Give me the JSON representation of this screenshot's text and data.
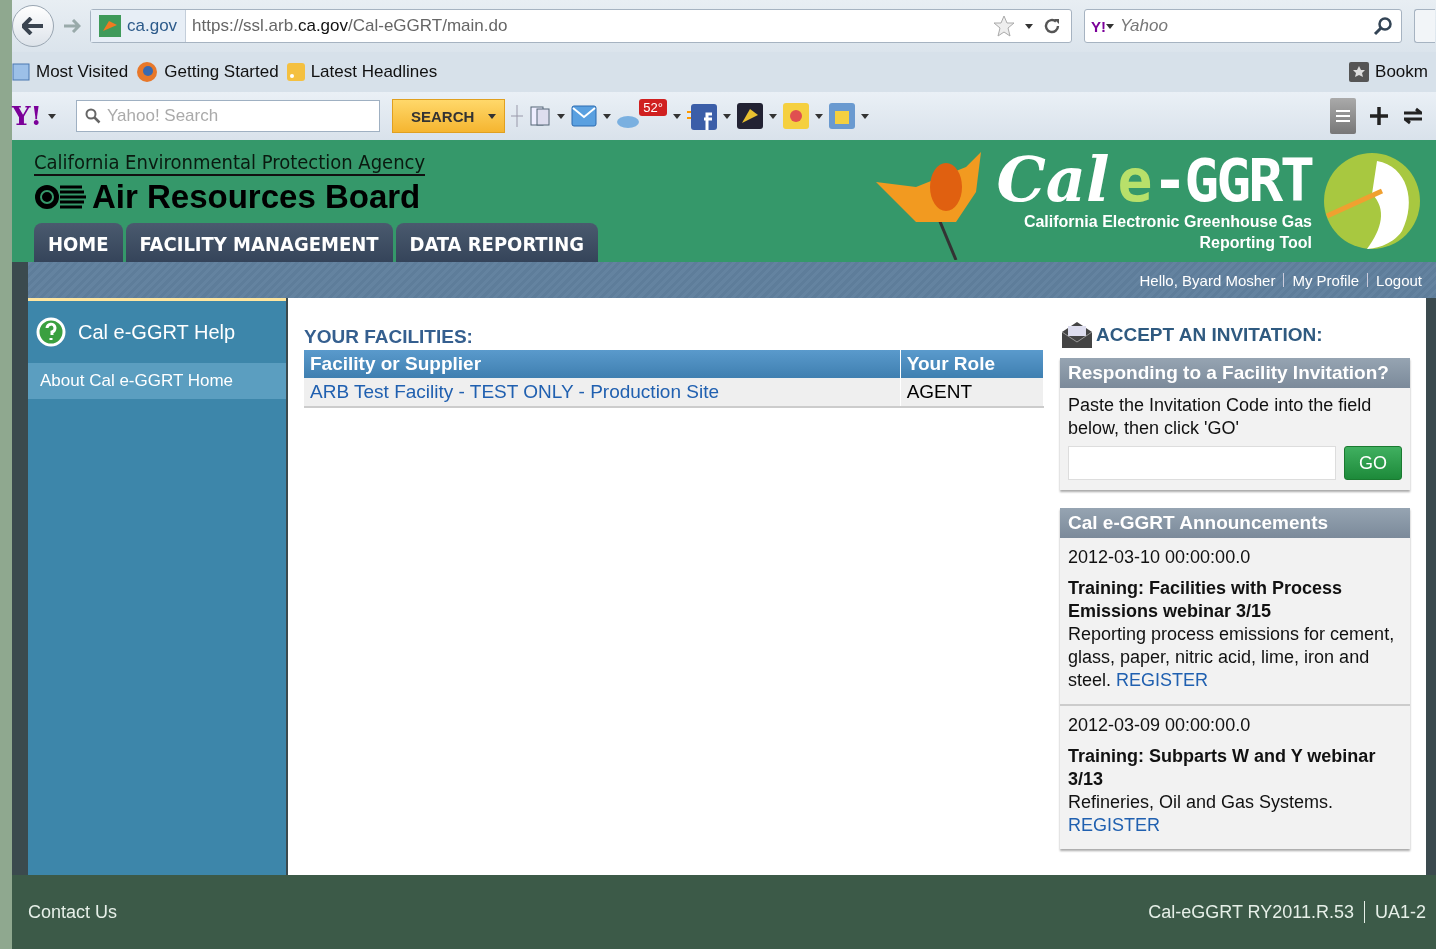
{
  "browser": {
    "site_label": "ca.gov",
    "url": "https://ssl.arb.**ca.gov**/Cal-eGGRT/main.do",
    "search_logo": "Y!",
    "search_placeholder": "Yahoo",
    "bookmarks": [
      "Most Visited",
      "Getting Started",
      "Latest Headlines"
    ],
    "bookmarks_menu": "Bookm"
  },
  "yahoo_toolbar": {
    "logo": "Y!",
    "search_placeholder": "Yahoo! Search",
    "search_button": "SEARCH",
    "weather": "52°"
  },
  "header": {
    "agency": "California Environmental Protection Agency",
    "board": "Air Resources Board",
    "logo_parts": [
      {
        "text": "Cal",
        "kind": "script"
      },
      {
        "text": "e",
        "kind": "accent"
      },
      {
        "text": "-GGRT",
        "kind": "block"
      }
    ],
    "subtitle_lines": [
      "California Electronic Greenhouse Gas",
      "Reporting Tool"
    ]
  },
  "tabs": [
    "HOME",
    "FACILITY MANAGEMENT",
    "DATA REPORTING"
  ],
  "user_bar": [
    "Hello, Byard Mosher",
    "My Profile",
    "Logout"
  ],
  "sidebar": {
    "title": "Cal e-GGRT Help",
    "items": [
      {
        "label": "About Cal e-GGRT Home",
        "selected": true
      }
    ]
  },
  "facilities": {
    "title": "YOUR FACILITIES:",
    "columns": [
      "Facility or Supplier",
      "Your Role"
    ],
    "rows": [
      {
        "facility": "ARB Test Facility - TEST ONLY - Production Site",
        "role": "AGENT"
      }
    ]
  },
  "invitation": {
    "title": "ACCEPT AN INVITATION:",
    "panel_title": "Responding to a Facility Invitation?",
    "instructions": "Paste the Invitation Code into the field below, then click 'GO'",
    "button": "GO"
  },
  "announcements": {
    "title": "Cal e-GGRT Announcements",
    "items": [
      {
        "date": "2012-03-10 00:00:00.0",
        "headline": "Training: Facilities with Process Emissions webinar 3/15",
        "body": "Reporting process emissions for cement, glass, paper, nitric acid, lime, iron and steel.",
        "link": "REGISTER"
      },
      {
        "date": "2012-03-09 00:00:00.0",
        "headline": "Training: Subparts W and Y webinar 3/13",
        "body": "Refineries, Oil and Gas Systems.",
        "link": "REGISTER"
      }
    ]
  },
  "footer": {
    "contact": "Contact Us",
    "version": "Cal-eGGRT RY2011.R.53",
    "server": "UA1-2"
  }
}
